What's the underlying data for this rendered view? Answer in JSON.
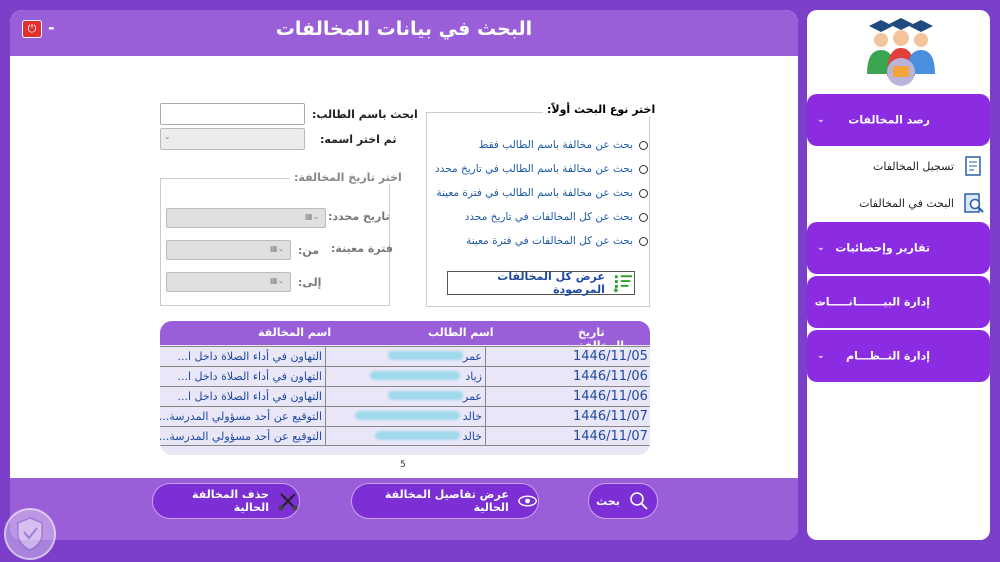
{
  "window": {
    "title": "البحث في بيانات المخالفات",
    "minimize": "-"
  },
  "search": {
    "student_label": "ابحث باسم الطالب:",
    "select_name_label": "ثم اختر اسمه:",
    "type_group_title": "اختر نوع البحث أولاً:",
    "options": [
      "بحث عن مخالفة باسم الطالب فقط",
      "بحث عن مخالفة باسم الطالب في تاريخ محدد",
      "بحث عن مخالفة باسم الطالب في فترة معينة",
      "بحث عن كل المخالفات في تاريخ محدد",
      "بحث عن كل المخالفات في فترة معينة"
    ],
    "show_all_label": "عرض كل المخالفات المرصودة",
    "date_group_title": "اختر تاريخ المخالفة:",
    "specific_date_label": "تاريخ محدد:",
    "period_label": "فترة معينة:",
    "from_label": "من:",
    "to_label": "إلى:"
  },
  "table": {
    "columns": [
      "تاريخ المخالفة",
      "اسم الطالب",
      "اسم المخالفة"
    ],
    "rows": [
      {
        "date": "1446/11/05",
        "name": "عمر",
        "violation": "التهاون في أداء الصلاة داخل ا..."
      },
      {
        "date": "1446/11/06",
        "name": "زياد",
        "violation": "التهاون في أداء الصلاة داخل ا..."
      },
      {
        "date": "1446/11/06",
        "name": "عمر",
        "violation": "التهاون في أداء الصلاة داخل ا..."
      },
      {
        "date": "1446/11/07",
        "name": "خالد",
        "violation": "التوقيع عن أحد مسؤولي المدرسة..."
      },
      {
        "date": "1446/11/07",
        "name": "خالد",
        "violation": "التوقيع عن أحد مسؤولي المدرسة..."
      }
    ],
    "count": "5"
  },
  "actions": {
    "search": "بحث",
    "details": "عرض تفاصيل المخالفة الحالية",
    "delete": "حذف المخالفة الحالية"
  },
  "sidebar": {
    "sections": [
      {
        "label": "رصد المخالفات"
      },
      {
        "label": "تقارير وإحصائيات"
      },
      {
        "label": "إدارة البيـــــــانـــــات"
      },
      {
        "label": "إدارة النــظـــام"
      }
    ],
    "items": [
      {
        "label": "تسجيل المخالفات"
      },
      {
        "label": "البحث في المخالفات"
      }
    ]
  },
  "colors": {
    "purple": "#7b3fc9",
    "header": "#9a5ed9",
    "accent": "#8b2be2",
    "link": "#1f5aa6"
  }
}
